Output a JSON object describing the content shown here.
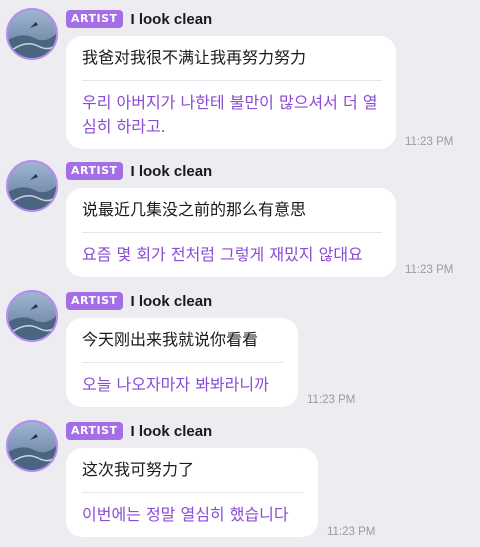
{
  "colors": {
    "background": "#ececf1",
    "badge": "#a46ee6",
    "translation_text": "#8a4bd8",
    "avatar_ring": "#b58cf0"
  },
  "messages": [
    {
      "badge": "ARTIST",
      "sender": "I look clean",
      "text": "我爸对我很不满让我再努力努力",
      "translation": "우리 아버지가 나한테 불만이 많으셔서 더 열심히 하라고.",
      "time": "11:23 PM"
    },
    {
      "badge": "ARTIST",
      "sender": "I look clean",
      "text": "说最近几集没之前的那么有意思",
      "translation": "요즘 몇 회가 전처럼 그렇게 재밌지 않대요",
      "time": "11:23 PM"
    },
    {
      "badge": "ARTIST",
      "sender": "I look clean",
      "text": "今天刚出来我就说你看看",
      "translation": "오늘 나오자마자 봐봐라니까",
      "time": "11:23 PM"
    },
    {
      "badge": "ARTIST",
      "sender": "I look clean",
      "text": "这次我可努力了",
      "translation": "이번에는 정말 열심히 했습니다",
      "time": "11:23 PM"
    }
  ]
}
